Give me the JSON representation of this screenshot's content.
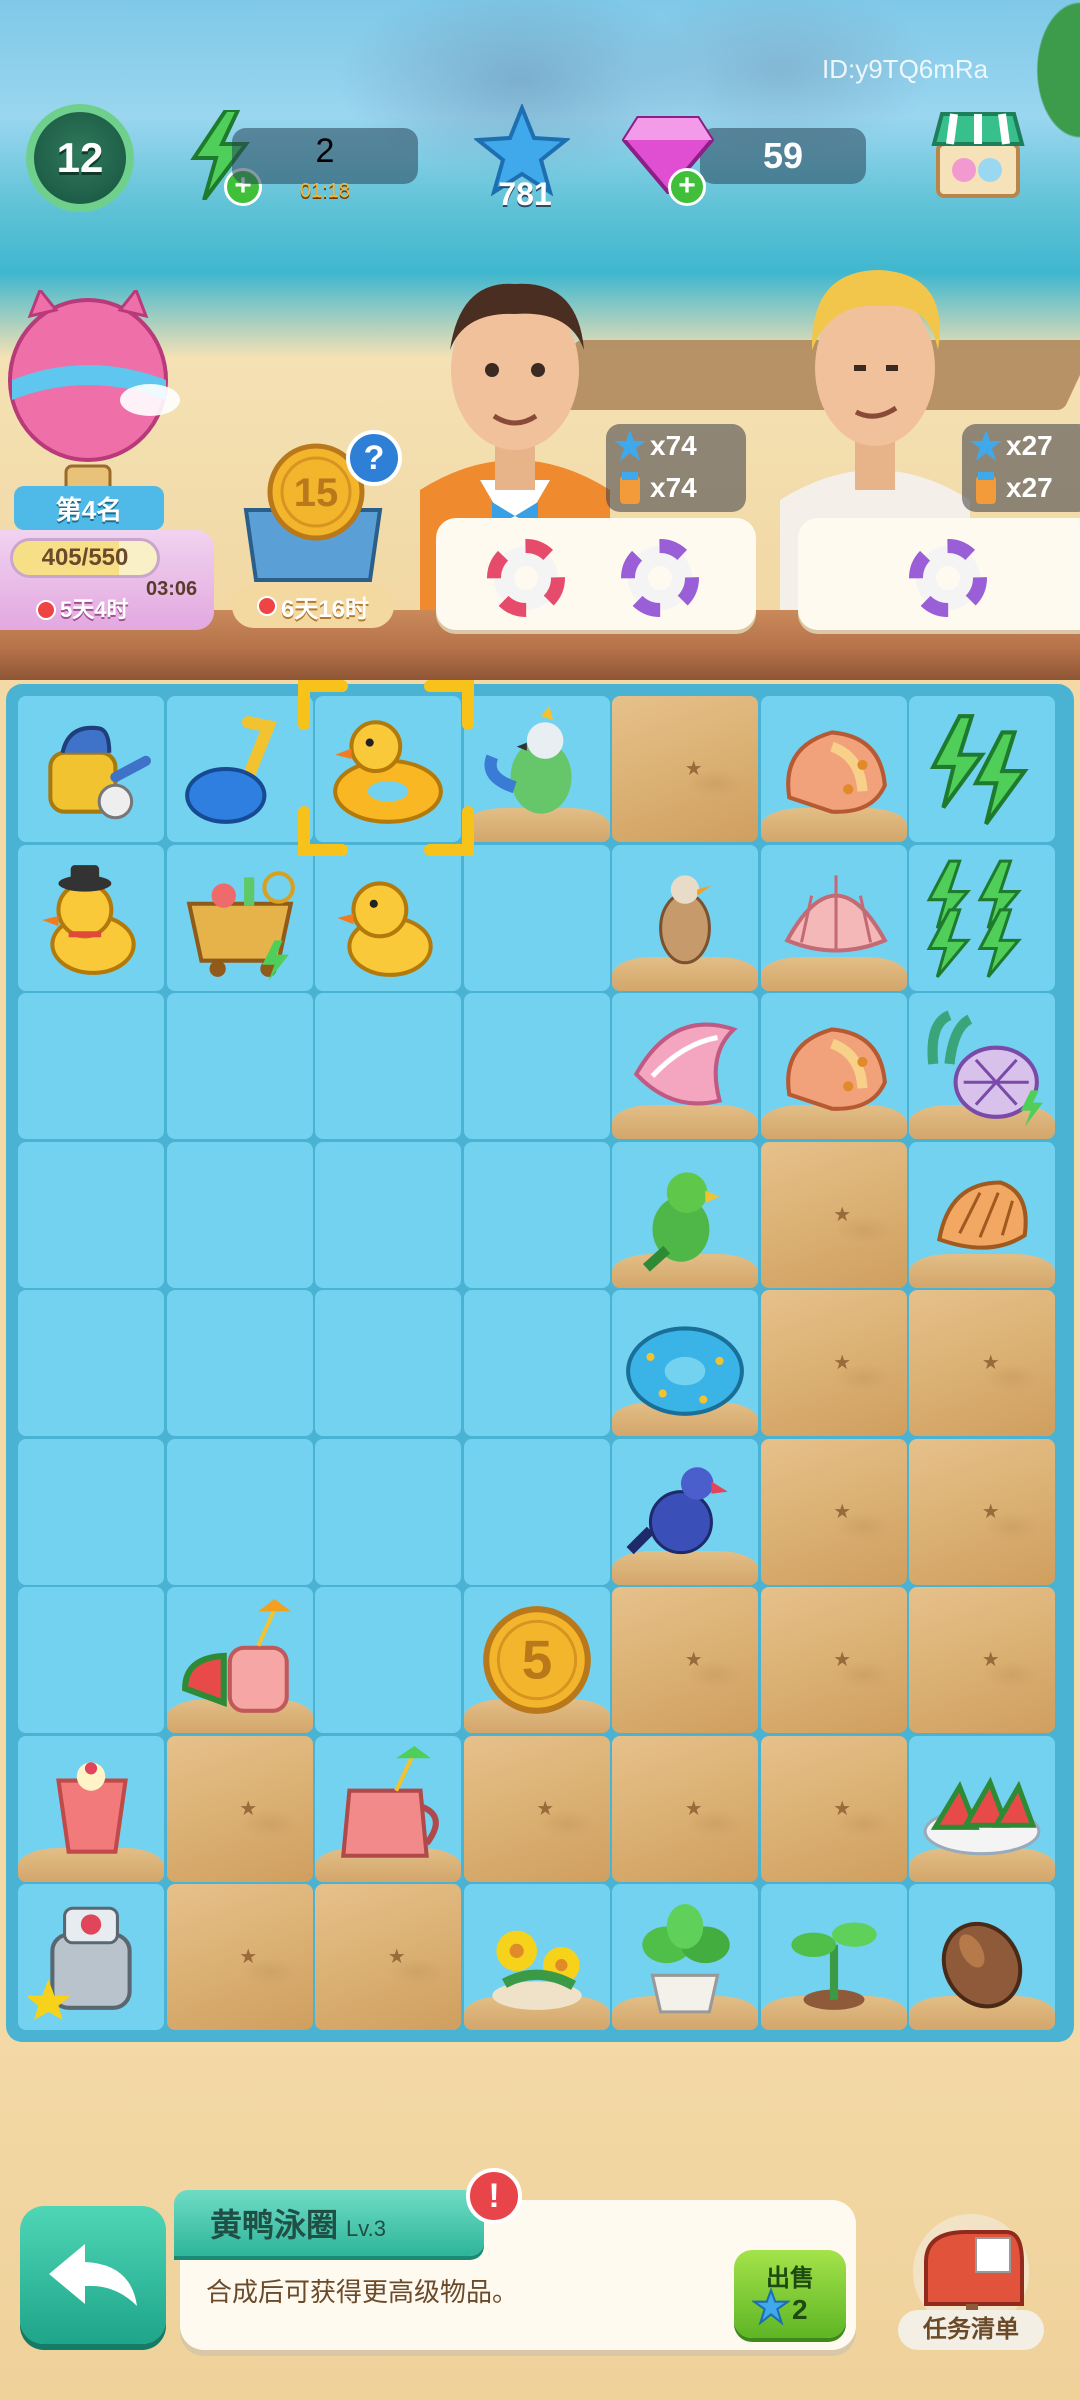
{
  "hud": {
    "level": "12",
    "energy": "2",
    "energy_timer": "01:18",
    "stars": "781",
    "gems": "59",
    "player_id": "ID:y9TQ6mRa"
  },
  "event": {
    "rank": "第4名",
    "progress_text": "405/550",
    "progress_fraction": 0.736,
    "countdown": "03:06",
    "days_left": "5天4时"
  },
  "box": {
    "coin_value": "15",
    "timer": "6天16时",
    "help": "?"
  },
  "customers": [
    {
      "req_stars": "x74",
      "req_drinks": "x74"
    },
    {
      "req_stars": "x27",
      "req_drinks": "x27"
    }
  ],
  "board": {
    "cols": 7,
    "rows": 9,
    "cells": [
      [
        "watering-can",
        "beach-shovel",
        "duck-float",
        "parrot",
        "sand",
        "conch-shell",
        "energy-2"
      ],
      [
        "rubber-duck-hat",
        "picnic-cart",
        "rubber-duck",
        "empty",
        "seagull",
        "scallop-shell",
        "energy-4"
      ],
      [
        "empty",
        "empty",
        "empty",
        "empty",
        "spiral-shell",
        "conch-shell",
        "coral-shell"
      ],
      [
        "empty",
        "empty",
        "empty",
        "empty",
        "green-parrot",
        "sand",
        "small-shell"
      ],
      [
        "empty",
        "empty",
        "empty",
        "empty",
        "donut-float",
        "sand",
        "sand"
      ],
      [
        "empty",
        "empty",
        "empty",
        "empty",
        "blue-bird",
        "sand",
        "sand"
      ],
      [
        "empty",
        "watermelon-juice",
        "empty",
        "coin-5",
        "sand",
        "sand",
        "sand"
      ],
      [
        "smoothie-glass",
        "sand",
        "juice-pitcher",
        "sand",
        "sand",
        "sand",
        "watermelon-plate"
      ],
      [
        "juicer",
        "sand",
        "sand",
        "yellow-flowers",
        "potted-plant",
        "sprout",
        "seed"
      ]
    ],
    "coin_label": "5",
    "selected": "duck-float"
  },
  "selected_item": {
    "name": "黄鸭泳圈",
    "level": "Lv.3",
    "description": "合成后可获得更高级物品。",
    "alert": "!",
    "sell_label": "出售",
    "sell_price": "2"
  },
  "task_button": "任务清单",
  "colors": {
    "board_blue": "#72d2ef",
    "sand": "#d9ad6f",
    "accent_green": "#2eb59a"
  }
}
